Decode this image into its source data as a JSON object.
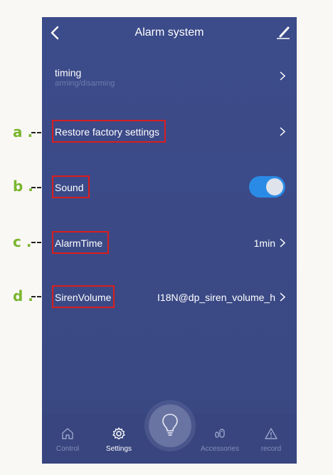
{
  "header": {
    "title": "Alarm system"
  },
  "settings": [
    {
      "label": "timing",
      "sublabel": "arming/disarming",
      "value": ""
    },
    {
      "label": "Restore factory settings",
      "value": ""
    },
    {
      "label": "Sound",
      "toggle_on": true
    },
    {
      "label": "AlarmTime",
      "value": "1min"
    },
    {
      "label": "SirenVolume",
      "value": "I18N@dp_siren_volume_h"
    }
  ],
  "annotations": [
    "a .",
    "b .",
    "c .",
    "d ."
  ],
  "tabbar": {
    "items": [
      {
        "label": "Control",
        "icon": "home-icon",
        "active": false
      },
      {
        "label": "Settings",
        "icon": "gear-icon",
        "active": true
      },
      {
        "label": "",
        "icon": "bulb-icon",
        "active": false
      },
      {
        "label": "Accessories",
        "icon": "accessories-icon",
        "active": false
      },
      {
        "label": "record",
        "icon": "warning-icon",
        "active": false
      }
    ]
  },
  "colors": {
    "background": "#3b4a87",
    "toggle_on": "#2a8be6",
    "annotation_letter": "#7ab62e",
    "highlight_box": "#d91e1e"
  }
}
